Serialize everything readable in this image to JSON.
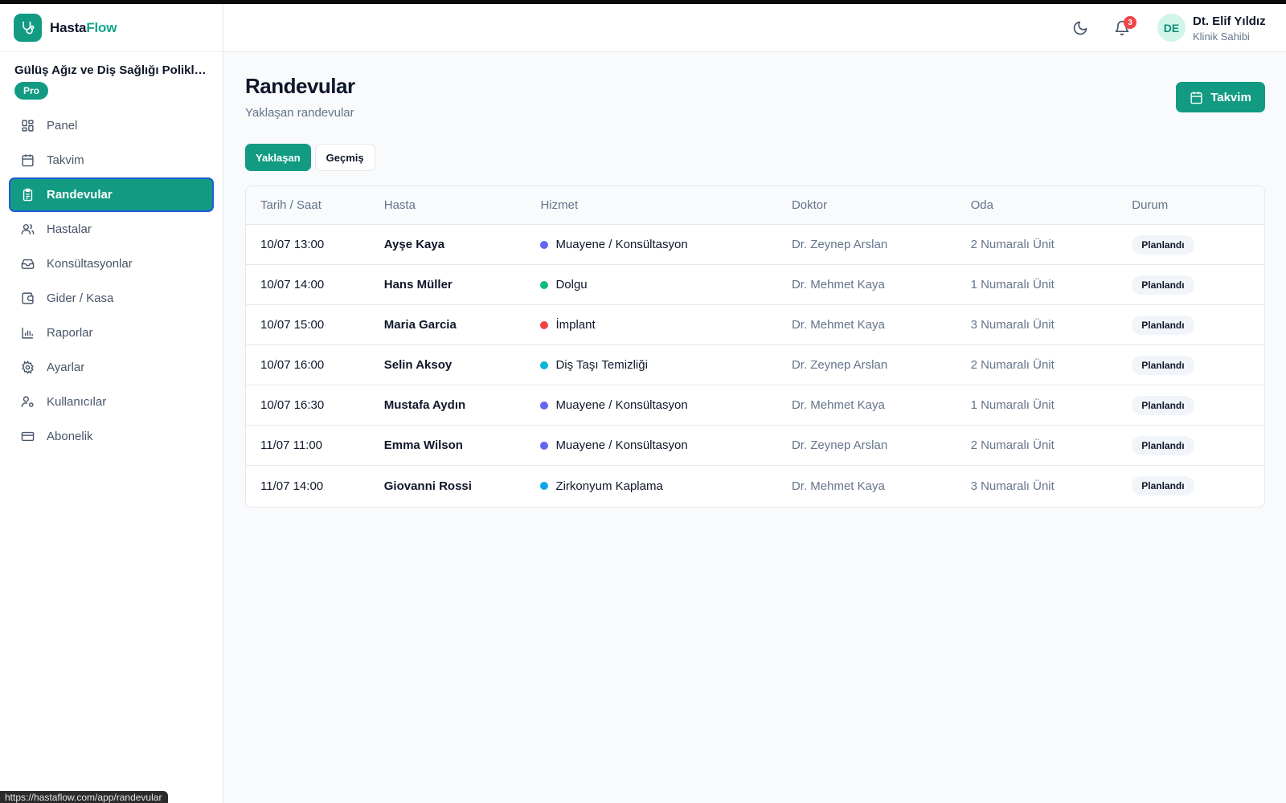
{
  "browser": {
    "status_url": "https://hastaflow.com/app/randevular"
  },
  "brand": {
    "name_part1": "Hasta",
    "name_part2": "Flow",
    "accent_color": "#12a58a"
  },
  "clinic": {
    "name": "Gülüş Ağız ve Diş Sağlığı Polikli...",
    "plan": "Pro"
  },
  "sidebar": {
    "items": [
      {
        "label": "Panel",
        "icon": "grid-icon"
      },
      {
        "label": "Takvim",
        "icon": "calendar-icon"
      },
      {
        "label": "Randevular",
        "icon": "clipboard-icon",
        "active": true
      },
      {
        "label": "Hastalar",
        "icon": "users-icon"
      },
      {
        "label": "Konsültasyonlar",
        "icon": "inbox-icon"
      },
      {
        "label": "Gider / Kasa",
        "icon": "wallet-icon"
      },
      {
        "label": "Raporlar",
        "icon": "bar-chart-icon"
      },
      {
        "label": "Ayarlar",
        "icon": "gear-icon"
      },
      {
        "label": "Kullanıcılar",
        "icon": "user-gear-icon"
      },
      {
        "label": "Abonelik",
        "icon": "credit-card-icon"
      }
    ]
  },
  "header": {
    "notification_count": "3",
    "user": {
      "initials": "DE",
      "name": "Dt. Elif Yıldız",
      "role": "Klinik Sahibi"
    }
  },
  "page": {
    "title": "Randevular",
    "subtitle": "Yaklaşan randevular",
    "calendar_button": "Takvim",
    "tabs": [
      "Yaklaşan",
      "Geçmiş"
    ]
  },
  "table": {
    "columns": [
      "Tarih / Saat",
      "Hasta",
      "Hizmet",
      "Doktor",
      "Oda",
      "Durum"
    ],
    "rows": [
      {
        "datetime": "10/07 13:00",
        "patient": "Ayşe Kaya",
        "service": "Muayene / Konsültasyon",
        "service_color": "#6366f1",
        "doctor": "Dr. Zeynep Arslan",
        "room": "2 Numaralı Ünit",
        "status": "Planlandı"
      },
      {
        "datetime": "10/07 14:00",
        "patient": "Hans Müller",
        "service": "Dolgu",
        "service_color": "#10b981",
        "doctor": "Dr. Mehmet Kaya",
        "room": "1 Numaralı Ünit",
        "status": "Planlandı"
      },
      {
        "datetime": "10/07 15:00",
        "patient": "Maria Garcia",
        "service": "İmplant",
        "service_color": "#ef4444",
        "doctor": "Dr. Mehmet Kaya",
        "room": "3 Numaralı Ünit",
        "status": "Planlandı"
      },
      {
        "datetime": "10/07 16:00",
        "patient": "Selin Aksoy",
        "service": "Diş Taşı Temizliği",
        "service_color": "#06b6d4",
        "doctor": "Dr. Zeynep Arslan",
        "room": "2 Numaralı Ünit",
        "status": "Planlandı"
      },
      {
        "datetime": "10/07 16:30",
        "patient": "Mustafa Aydın",
        "service": "Muayene / Konsültasyon",
        "service_color": "#6366f1",
        "doctor": "Dr. Mehmet Kaya",
        "room": "1 Numaralı Ünit",
        "status": "Planlandı"
      },
      {
        "datetime": "11/07 11:00",
        "patient": "Emma Wilson",
        "service": "Muayene / Konsültasyon",
        "service_color": "#6366f1",
        "doctor": "Dr. Zeynep Arslan",
        "room": "2 Numaralı Ünit",
        "status": "Planlandı"
      },
      {
        "datetime": "11/07 14:00",
        "patient": "Giovanni Rossi",
        "service": "Zirkonyum Kaplama",
        "service_color": "#0ea5e9",
        "doctor": "Dr. Mehmet Kaya",
        "room": "3 Numaralı Ünit",
        "status": "Planlandı"
      }
    ]
  }
}
